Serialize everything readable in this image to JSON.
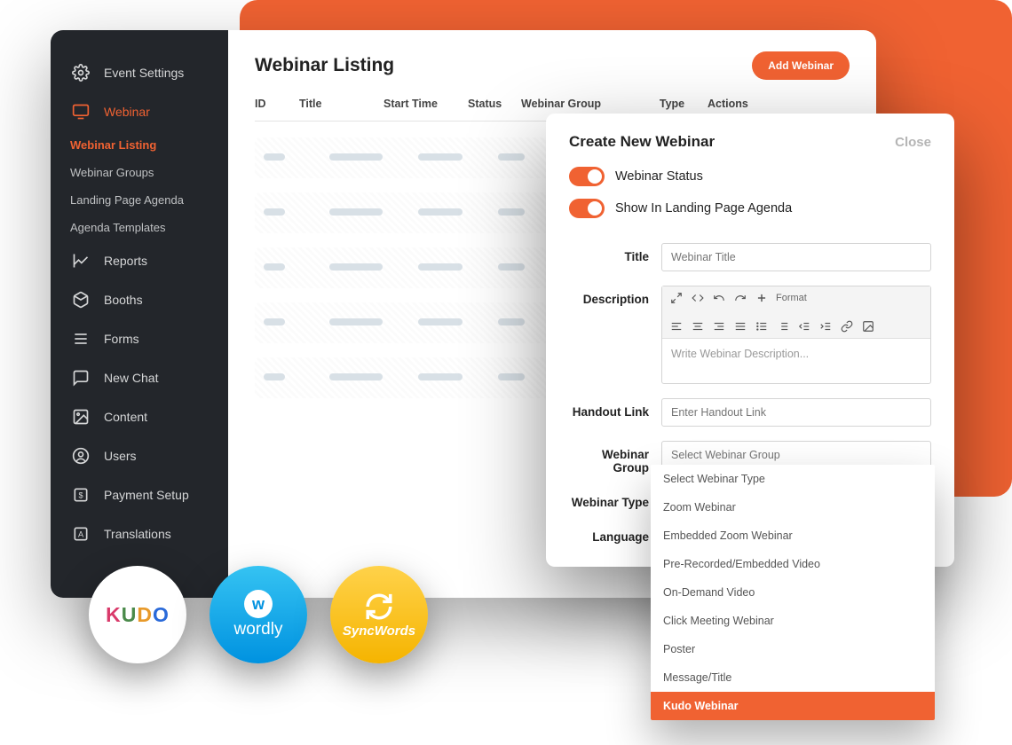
{
  "colors": {
    "accent": "#f06232",
    "sidebar_bg": "#23262b"
  },
  "sidebar": {
    "event_settings": "Event Settings",
    "webinar": "Webinar",
    "subitems": [
      {
        "label": "Webinar Listing",
        "active": true
      },
      {
        "label": "Webinar Groups"
      },
      {
        "label": "Landing Page Agenda"
      },
      {
        "label": "Agenda Templates"
      }
    ],
    "reports": "Reports",
    "booths": "Booths",
    "forms": "Forms",
    "new_chat": "New Chat",
    "content": "Content",
    "users": "Users",
    "payment_setup": "Payment Setup",
    "translations": "Translations"
  },
  "page": {
    "title": "Webinar Listing",
    "add_button": "Add Webinar",
    "columns": {
      "id": "ID",
      "title": "Title",
      "start_time": "Start Time",
      "status": "Status",
      "group": "Webinar Group",
      "type": "Type",
      "actions": "Actions"
    }
  },
  "create": {
    "title": "Create New Webinar",
    "close": "Close",
    "toggle_status": {
      "label": "Webinar Status",
      "value": true
    },
    "toggle_agenda": {
      "label": "Show In Landing Page Agenda",
      "value": true
    },
    "field_title": {
      "label": "Title",
      "placeholder": "Webinar Title"
    },
    "field_description": {
      "label": "Description",
      "placeholder": "Write Webinar Description..."
    },
    "editor_format": "Format",
    "field_handout": {
      "label": "Handout Link",
      "placeholder": "Enter Handout Link"
    },
    "field_group": {
      "label": "Webinar  Group",
      "placeholder": "Select Webinar Group"
    },
    "field_type": {
      "label": "Webinar Type"
    },
    "field_language": {
      "label": "Language"
    }
  },
  "webinar_type_options": [
    "Select Webinar Type",
    "Zoom Webinar",
    "Embedded Zoom Webinar",
    "Pre-Recorded/Embedded Video",
    "On-Demand Video",
    "Click Meeting Webinar",
    "Poster",
    "Message/Title",
    "Kudo Webinar"
  ],
  "webinar_type_selected": "Kudo Webinar",
  "logos": {
    "kudo": "KUDO",
    "wordly": "wordly",
    "syncwords": "SyncWords"
  }
}
